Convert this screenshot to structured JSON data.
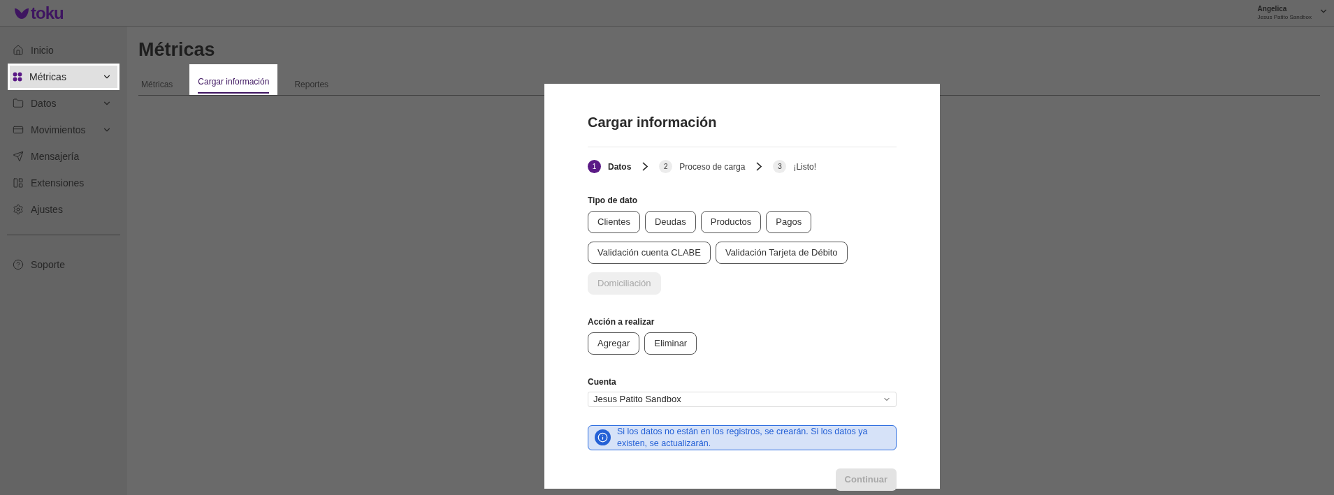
{
  "header": {
    "logo": "toku",
    "user_name": "Angelica",
    "user_account": "Jesus Patito Sandbox"
  },
  "sidebar": {
    "items": [
      {
        "label": "Inicio",
        "selected": false,
        "expandable": false
      },
      {
        "label": "Métricas",
        "selected": true,
        "expandable": true
      },
      {
        "label": "Datos",
        "selected": false,
        "expandable": true
      },
      {
        "label": "Movimientos",
        "selected": false,
        "expandable": true
      },
      {
        "label": "Mensajería",
        "selected": false,
        "expandable": false
      },
      {
        "label": "Extensiones",
        "selected": false,
        "expandable": false
      },
      {
        "label": "Ajustes",
        "selected": false,
        "expandable": false
      }
    ],
    "footer_items": [
      {
        "label": "Soporte"
      }
    ]
  },
  "page": {
    "title": "Métricas",
    "tabs": [
      {
        "label": "Métricas",
        "selected": false
      },
      {
        "label": "Cargar información",
        "selected": true
      },
      {
        "label": "Reportes",
        "selected": false
      }
    ]
  },
  "modal": {
    "title": "Cargar información",
    "steps": [
      {
        "number": "1",
        "label": "Datos",
        "selected": true
      },
      {
        "number": "2",
        "label": "Proceso de carga",
        "selected": false
      },
      {
        "number": "3",
        "label": "¡Listo!",
        "selected": false
      }
    ],
    "data_type": {
      "label": "Tipo de dato",
      "options": [
        {
          "label": "Clientes",
          "selected": false,
          "disabled": false
        },
        {
          "label": "Deudas",
          "selected": false,
          "disabled": false
        },
        {
          "label": "Productos",
          "selected": false,
          "disabled": false
        },
        {
          "label": "Pagos",
          "selected": false,
          "disabled": false
        },
        {
          "label": "Validación cuenta CLABE",
          "selected": false,
          "disabled": false
        },
        {
          "label": "Validación Tarjeta de Débito",
          "selected": false,
          "disabled": false
        },
        {
          "label": "Domiciliación",
          "selected": false,
          "disabled": true
        }
      ]
    },
    "action": {
      "label": "Acción a realizar",
      "options": [
        {
          "label": "Agregar",
          "selected": false
        },
        {
          "label": "Eliminar",
          "selected": false
        }
      ]
    },
    "account": {
      "label": "Cuenta",
      "value": "Jesus Patito Sandbox"
    },
    "info": "Si los datos no están en los registros, se crearán. Si los datos ya existen, se actualizarán.",
    "continue_button": {
      "label": "Continuar",
      "disabled": true
    }
  }
}
